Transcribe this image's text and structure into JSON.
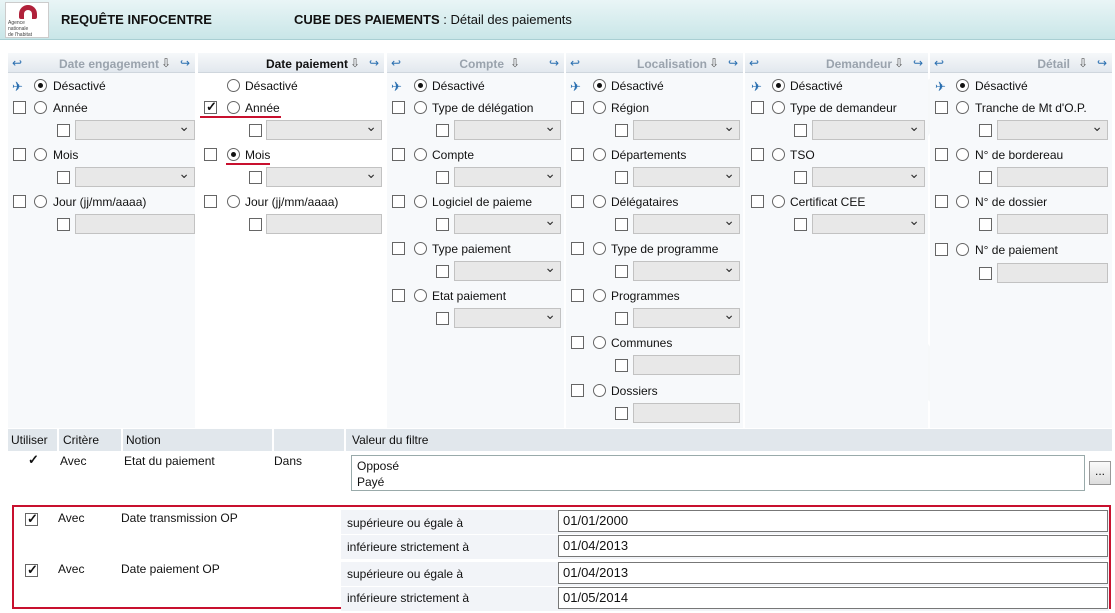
{
  "header": {
    "title": "REQUÊTE INFOCENTRE",
    "cube_name": "CUBE DES PAIEMENTS",
    "cube_detail": " : Détail des paiements",
    "logo_text": [
      "Agence",
      "nationale",
      "de l'habitat"
    ]
  },
  "columns": [
    {
      "title": "Date engagement",
      "items": [
        "Désactivé",
        "Année",
        "Mois",
        "Jour (jj/mm/aaaa)"
      ]
    },
    {
      "title": "Date paiement",
      "items": [
        "Désactivé",
        "Année",
        "Mois",
        "Jour (jj/mm/aaaa)"
      ]
    },
    {
      "title": "Compte",
      "items": [
        "Désactivé",
        "Type de délégation",
        "Compte",
        "Logiciel de paieme",
        "Type paiement",
        "Etat paiement"
      ]
    },
    {
      "title": "Localisation",
      "items": [
        "Désactivé",
        "Région",
        "Départements",
        "Délégataires",
        "Type de programme",
        "Programmes",
        "Communes",
        "Dossiers"
      ]
    },
    {
      "title": "Demandeur",
      "items": [
        "Désactivé",
        "Type de demandeur",
        "TSO",
        "Certificat CEE"
      ]
    },
    {
      "title": "Détail",
      "items": [
        "Désactivé",
        "Tranche de Mt d'O.P.",
        "N° de bordereau",
        "N° de dossier",
        "N° de paiement"
      ]
    }
  ],
  "filters": {
    "headers": [
      "Utiliser",
      "Critère",
      "Notion",
      "",
      "Valeur du filtre"
    ],
    "row1": {
      "critere": "Avec",
      "notion": "Etat du paiement",
      "operator": "Dans",
      "values": [
        "Opposé",
        "Payé"
      ],
      "button": "..."
    },
    "row2": {
      "critere": "Avec",
      "notion": "Date transmission OP",
      "op1": "supérieure ou égale à",
      "val1": "01/01/2000",
      "op2": "inférieure strictement à",
      "val2": "01/04/2013"
    },
    "row3": {
      "critere": "Avec",
      "notion": "Date paiement OP",
      "op1": "supérieure ou égale à",
      "val1": "01/04/2013",
      "op2": "inférieure strictement à",
      "val2": "01/05/2014"
    }
  },
  "colors": {
    "accent_red": "#c8102e",
    "header_bg": "#c9e6e8",
    "link_blue": "#2a6fb0"
  }
}
